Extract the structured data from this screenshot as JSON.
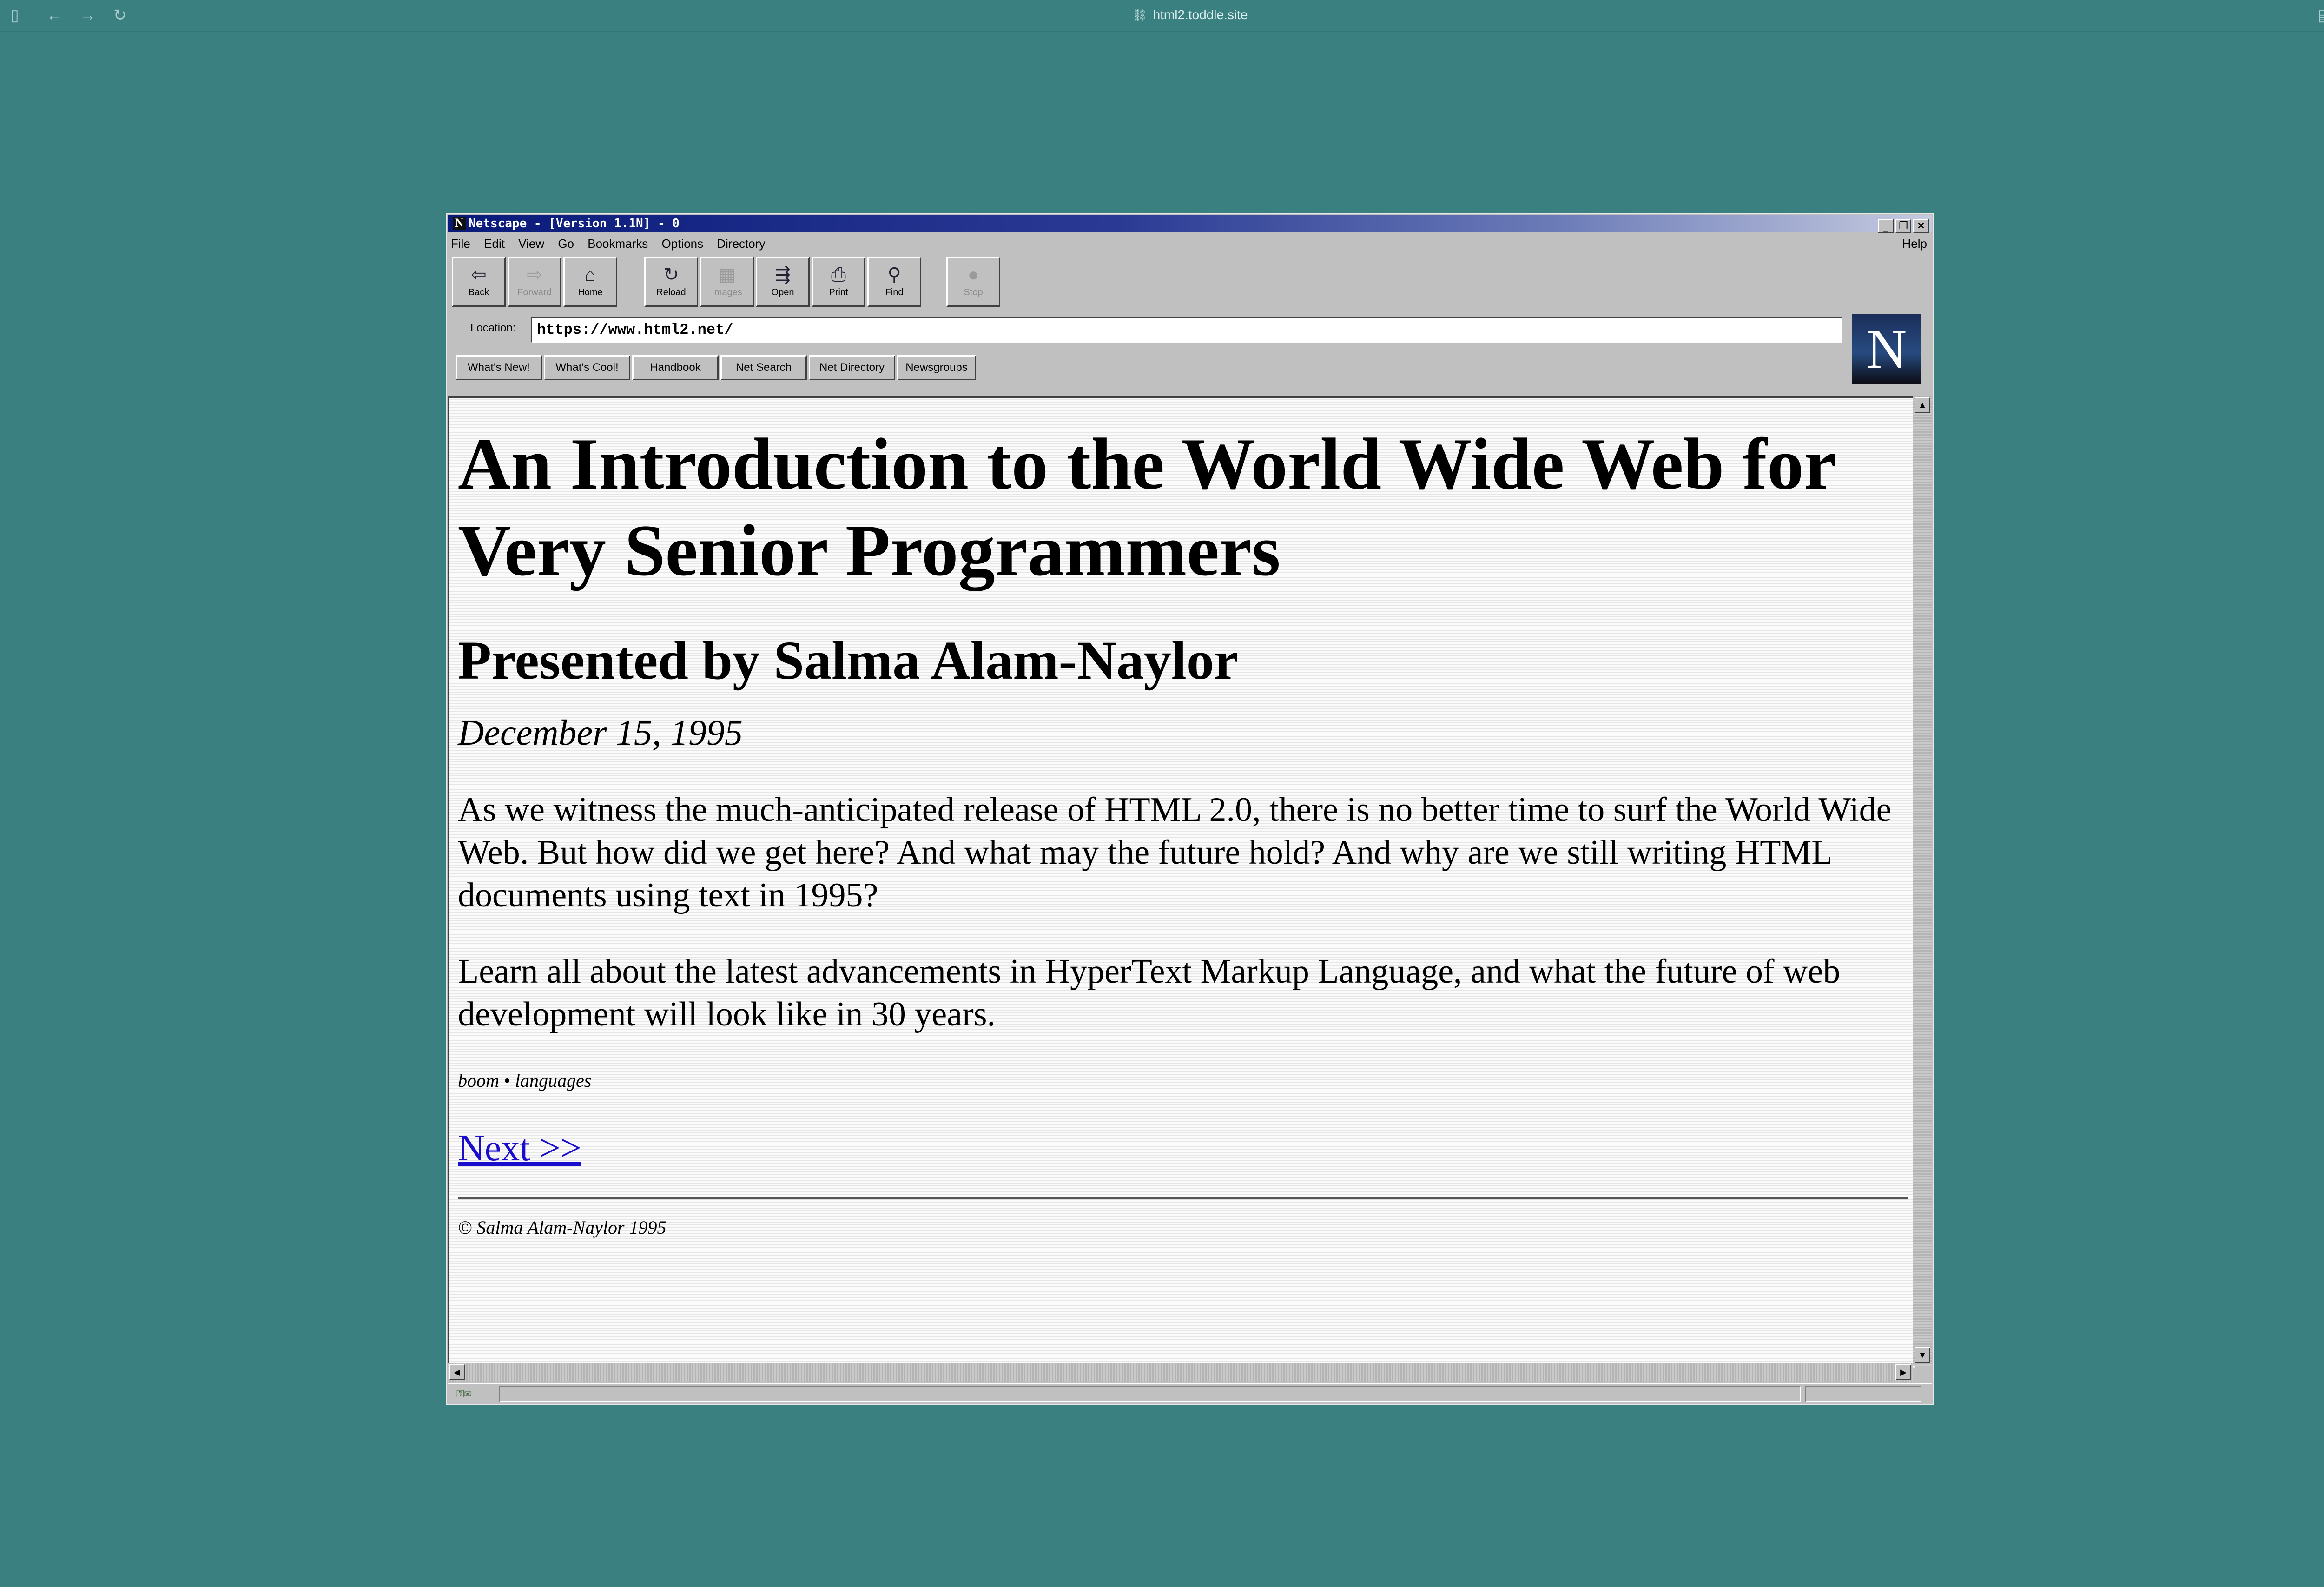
{
  "host": {
    "url": "html2.toddle.site"
  },
  "window": {
    "title": "Netscape - [Version 1.1N] - 0",
    "buttons": [
      "_",
      "❐",
      "✕"
    ]
  },
  "menu": {
    "items": [
      "File",
      "Edit",
      "View",
      "Go",
      "Bookmarks",
      "Options",
      "Directory"
    ],
    "help": "Help"
  },
  "toolbar": {
    "buttons": [
      {
        "label": "Back",
        "icon": "back-arrow-icon",
        "enabled": true
      },
      {
        "label": "Forward",
        "icon": "forward-arrow-icon",
        "enabled": false
      },
      {
        "label": "Home",
        "icon": "home-icon",
        "enabled": true
      },
      {
        "label": "Reload",
        "icon": "reload-icon",
        "enabled": true
      },
      {
        "label": "Images",
        "icon": "images-icon",
        "enabled": false
      },
      {
        "label": "Open",
        "icon": "open-icon",
        "enabled": true
      },
      {
        "label": "Print",
        "icon": "print-icon",
        "enabled": true
      },
      {
        "label": "Find",
        "icon": "find-icon",
        "enabled": true
      },
      {
        "label": "Stop",
        "icon": "stop-icon",
        "enabled": false
      }
    ]
  },
  "location": {
    "label": "Location:",
    "value": "https://www.html2.net/"
  },
  "logo": "N",
  "directory_buttons": [
    "What's New!",
    "What's Cool!",
    "Handbook",
    "Net Search",
    "Net Directory",
    "Newsgroups"
  ],
  "page": {
    "title": "An Introduction to the World Wide Web for Very Senior Programmers",
    "subtitle": "Presented by Salma Alam-Naylor",
    "date": "December 15, 1995",
    "paragraphs": [
      "As we witness the much-anticipated release of HTML 2.0, there is no better time to surf the World Wide Web. But how did we get here? And what may the future hold? And why are we still writing HTML documents using text in 1995?",
      "Learn all about the latest advancements in HyperText Markup Language, and what the future of web development will look like in 30 years."
    ],
    "tags": "boom • languages",
    "next_link": "Next >>",
    "copyright": "© Salma Alam-Naylor 1995"
  },
  "colors": {
    "desktop": "#3a8080",
    "chrome": "#c0c0c0",
    "link": "#1a0dcc",
    "titlebar": "#0a1a7a"
  }
}
